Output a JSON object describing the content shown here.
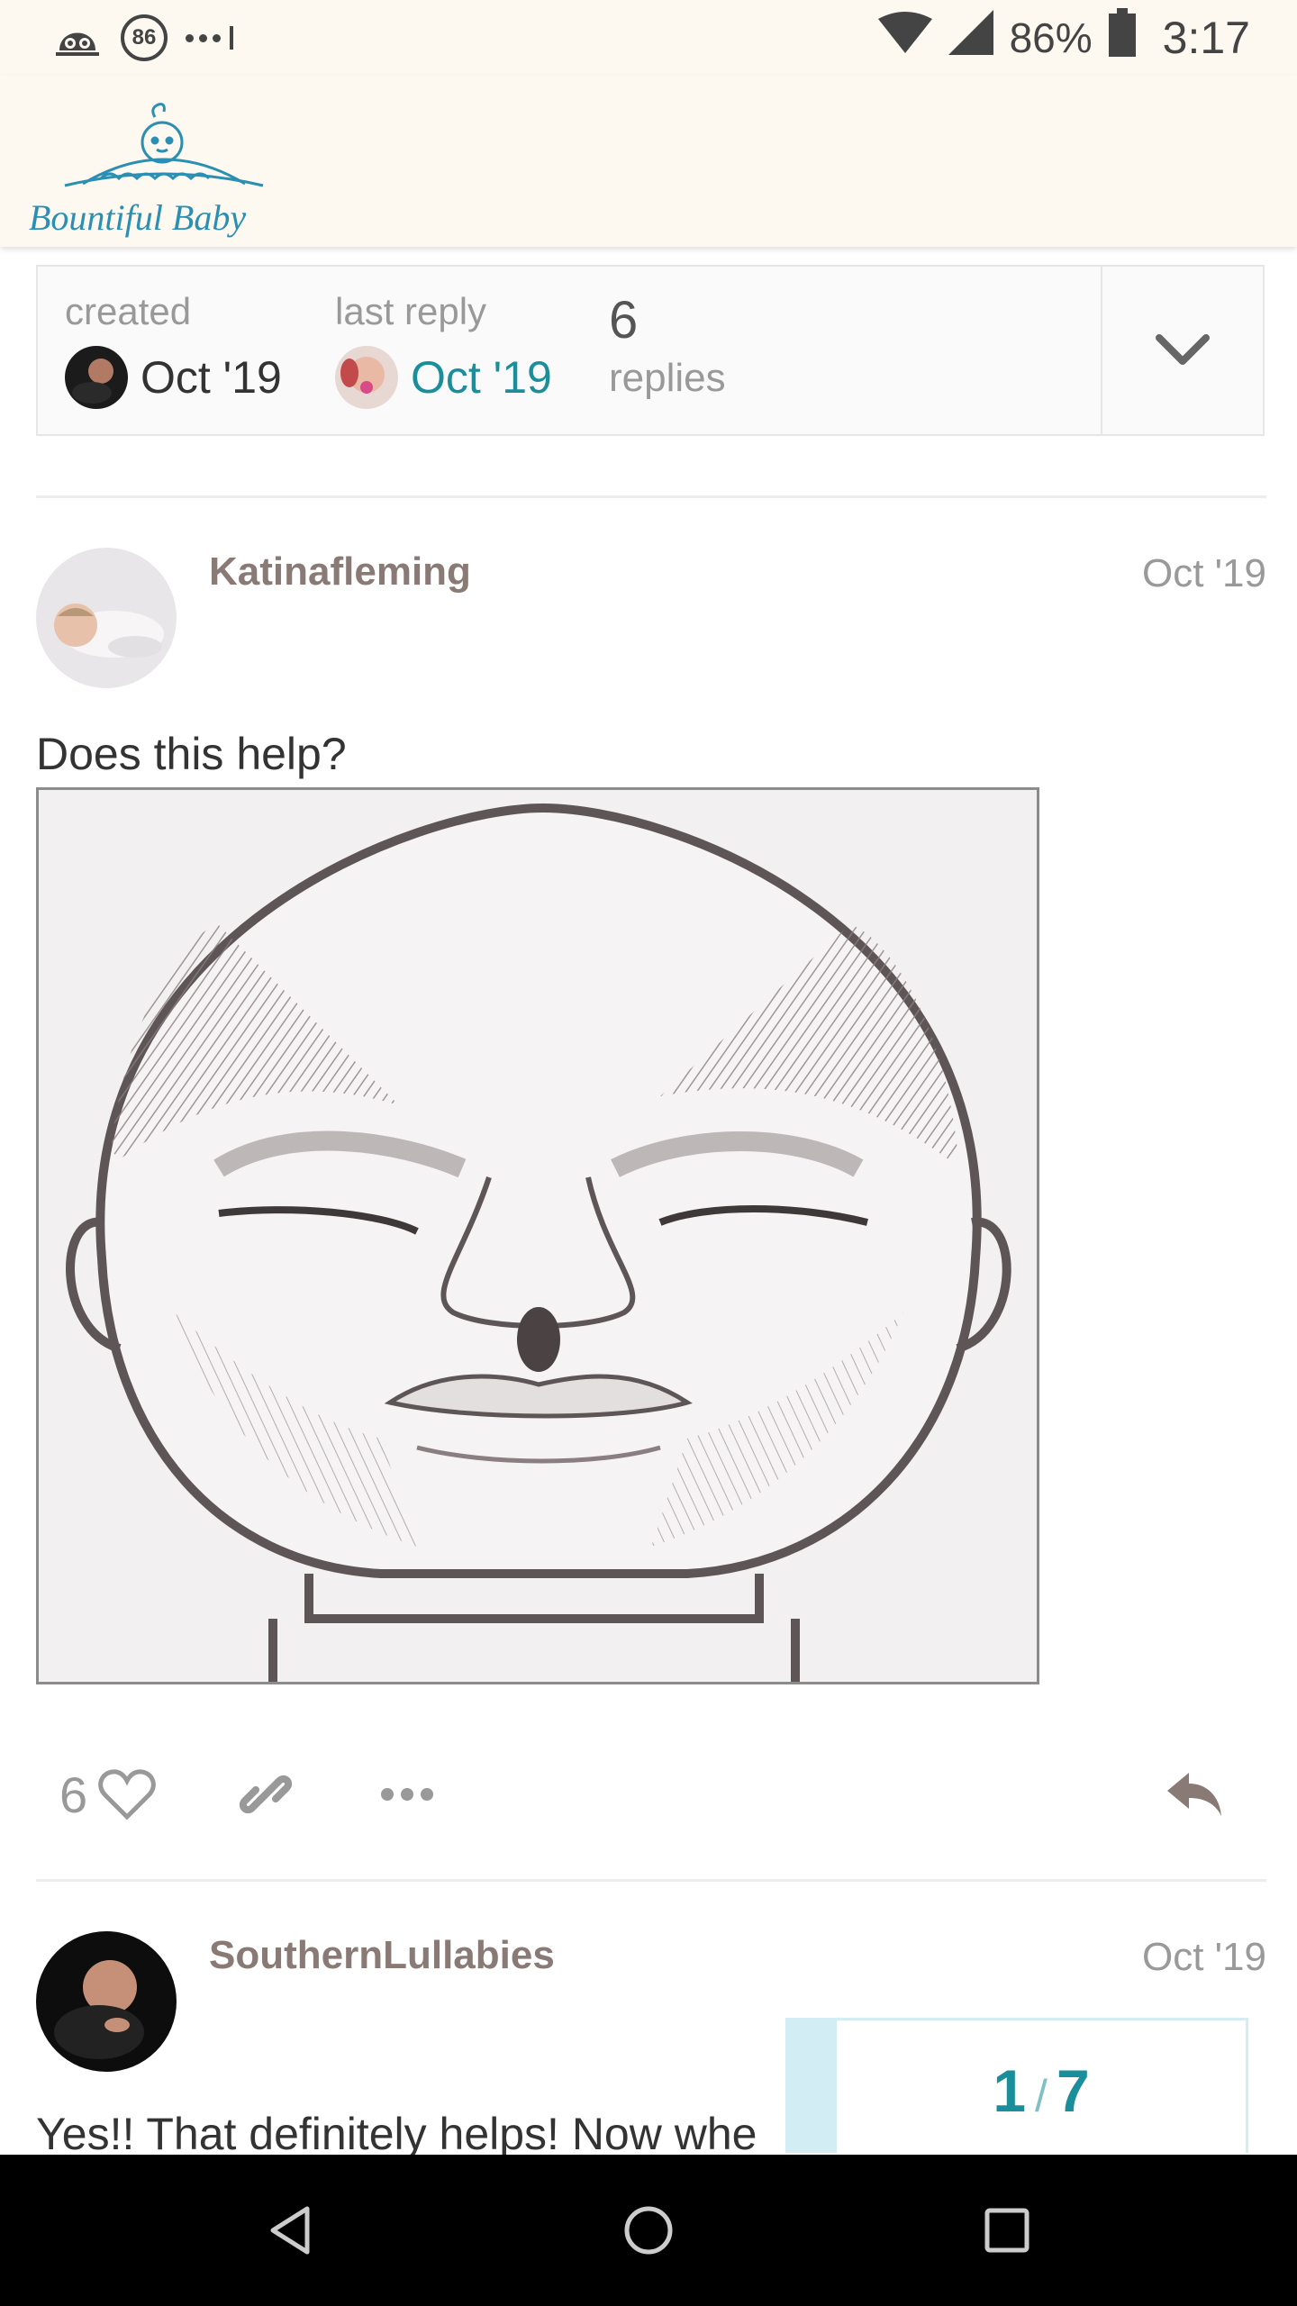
{
  "status_bar": {
    "notification_badge": "86",
    "battery_percent": "86%",
    "time": "3:17"
  },
  "header": {
    "logo_text": "Bountiful Baby"
  },
  "topic_map": {
    "created_label": "created",
    "created_date": "Oct '19",
    "last_reply_label": "last reply",
    "last_reply_date": "Oct '19",
    "replies_count": "6",
    "replies_label": "replies"
  },
  "posts": [
    {
      "username": "Katinafleming",
      "date": "Oct '19",
      "text": "Does this help?",
      "like_count": "6"
    },
    {
      "username": "SouthernLullabies",
      "date": "Oct '19",
      "text": "Yes!! That definitely helps! Now whe"
    }
  ],
  "timeline": {
    "current": "1",
    "separator": "/",
    "total": "7"
  },
  "colors": {
    "header_bg": "#fdf9f1",
    "link": "#1a8f9b",
    "username": "#8a7a75",
    "timeline_accent": "#d2eef4"
  },
  "icons": [
    "ghost-icon",
    "wifi-icon",
    "signal-icon",
    "battery-icon",
    "chevron-down-icon",
    "heart-icon",
    "link-icon",
    "more-icon",
    "reply-icon",
    "back-icon",
    "home-icon",
    "recents-icon"
  ]
}
